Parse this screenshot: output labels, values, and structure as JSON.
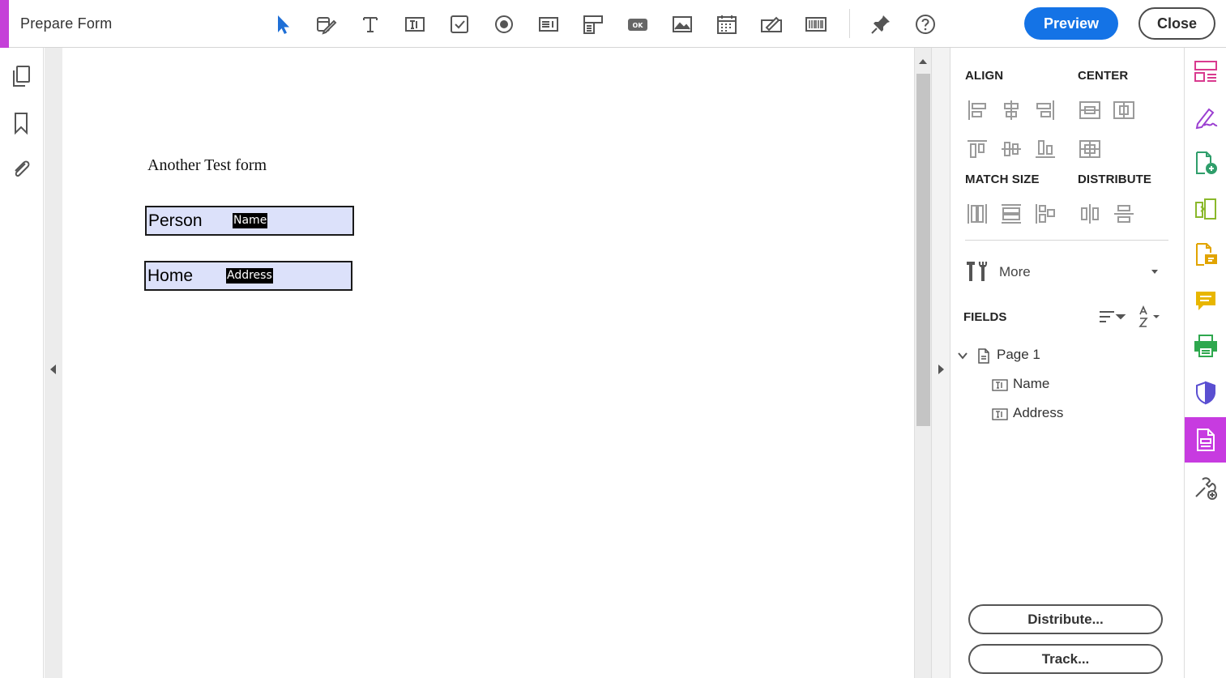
{
  "app": {
    "title": "Prepare Form"
  },
  "toolbar": {
    "tools": [
      {
        "icon": "select-arrow-icon"
      },
      {
        "icon": "edit-field-icon"
      },
      {
        "icon": "add-text-icon"
      },
      {
        "icon": "text-field-icon"
      },
      {
        "icon": "checkbox-icon"
      },
      {
        "icon": "radio-button-icon"
      },
      {
        "icon": "list-box-icon"
      },
      {
        "icon": "dropdown-icon"
      },
      {
        "icon": "button-field-icon"
      },
      {
        "icon": "image-field-icon"
      },
      {
        "icon": "date-field-icon"
      },
      {
        "icon": "signature-field-icon"
      },
      {
        "icon": "barcode-field-icon"
      },
      {
        "icon": "pin-icon"
      },
      {
        "icon": "help-icon"
      }
    ],
    "tool_ok_label": "OK",
    "preview_label": "Preview",
    "close_label": "Close"
  },
  "document": {
    "form_title": "Another Test form",
    "fields": [
      {
        "label": "Person",
        "tag": "Name"
      },
      {
        "label": "Home",
        "tag": "Address"
      }
    ]
  },
  "panel": {
    "align_heading": "ALIGN",
    "center_heading": "CENTER",
    "match_size_heading": "MATCH SIZE",
    "distribute_heading": "DISTRIBUTE",
    "more_label": "More",
    "fields_heading": "FIELDS",
    "tree": {
      "page_label": "Page 1",
      "items": [
        "Name",
        "Address"
      ]
    },
    "distribute_button": "Distribute...",
    "track_button": "Track..."
  },
  "colors": {
    "accent": "#c540d8",
    "preview_blue": "#1473e6",
    "field_fill": "#dce1fa",
    "rail_active": "#c73be0"
  }
}
